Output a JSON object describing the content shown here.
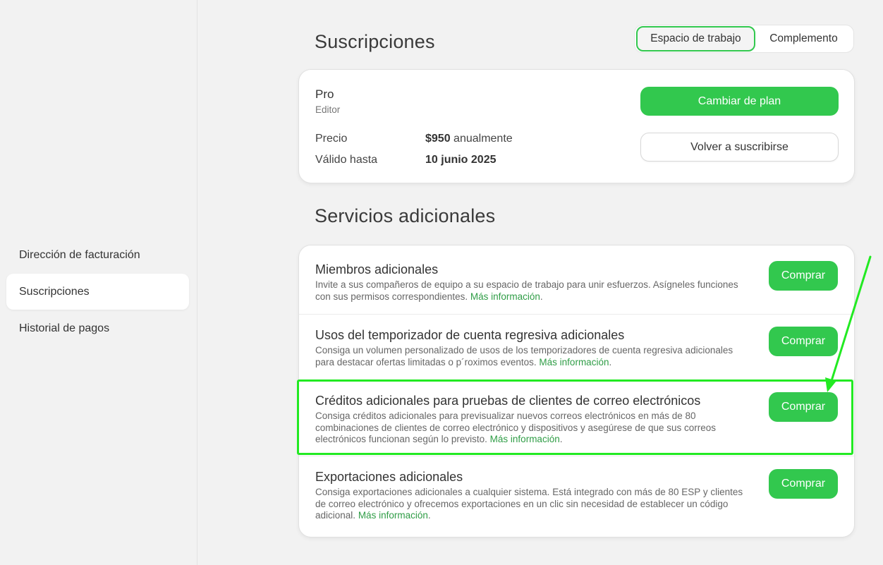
{
  "sidebar": {
    "items": [
      {
        "label": "Dirección de facturación"
      },
      {
        "label": "Suscripciones"
      },
      {
        "label": "Historial de pagos"
      }
    ]
  },
  "subscriptions": {
    "title": "Suscripciones",
    "toggle": {
      "workspace": "Espacio de trabajo",
      "addon": "Complemento"
    },
    "plan": {
      "name": "Pro",
      "role": "Editor",
      "price_label": "Precio",
      "price_amount": "$950",
      "price_period": "anualmente",
      "valid_label": "Válido hasta",
      "valid_value": "10 junio 2025",
      "change_plan": "Cambiar de plan",
      "resubscribe": "Volver a suscribirse"
    }
  },
  "services": {
    "title": "Servicios adicionales",
    "buy_label": "Comprar",
    "more_info": "Más información",
    "items": [
      {
        "title": "Miembros adicionales",
        "desc": "Invite a sus compañeros de equipo a su espacio de trabajo para unir esfuerzos. Asígneles funciones con sus permisos correspondientes."
      },
      {
        "title": "Usos del temporizador de cuenta regresiva adicionales",
        "desc": "Consiga un volumen personalizado de usos de los temporizadores de cuenta regresiva adicionales para destacar ofertas limitadas o p´roximos eventos."
      },
      {
        "title": "Créditos adicionales para pruebas de clientes de correo electrónicos",
        "desc": "Consiga créditos adicionales para previsualizar nuevos correos electrónicos en más de 80 combinaciones de clientes de correo electrónico y dispositivos y asegúrese de que sus correos electrónicos funcionan según lo previsto."
      },
      {
        "title": "Exportaciones adicionales",
        "desc": "Consiga exportaciones adicionales a cualquier sistema. Está integrado con más de 80 ESP y clientes de correo electrónico y ofrecemos exportaciones en un clic sin necesidad de establecer un código adicional."
      }
    ]
  },
  "colors": {
    "accent": "#32c84e",
    "highlight": "#22ea22",
    "link": "#2f9d46"
  }
}
